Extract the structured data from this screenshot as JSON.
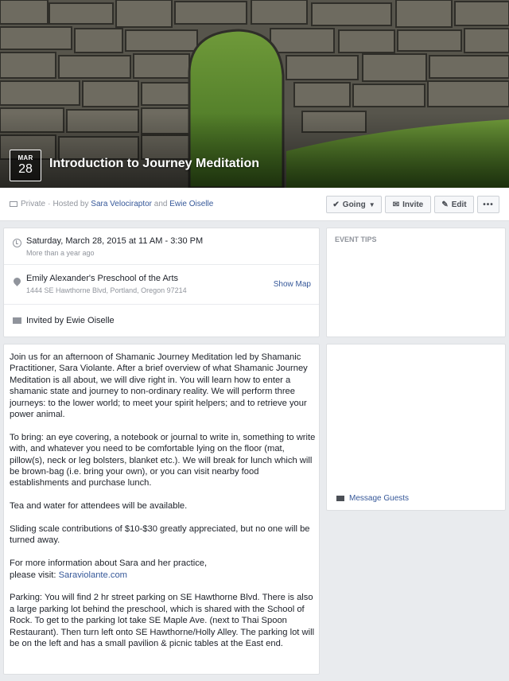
{
  "event": {
    "month": "MAR",
    "day": "28",
    "title": "Introduction to Journey Meditation"
  },
  "header": {
    "privacy": "Private",
    "hosted_by_prefix": "Hosted by",
    "host1": "Sara Velociraptor",
    "and": "and",
    "host2": "Ewie Oiselle",
    "buttons": {
      "going": "Going",
      "invite": "Invite",
      "edit": "Edit",
      "more": "•••"
    }
  },
  "details": {
    "datetime": "Saturday, March 28, 2015 at 11 AM - 3:30 PM",
    "relative": "More than a year ago",
    "venue": "Emily Alexander's Preschool of the Arts",
    "address": "1444 SE Hawthorne Blvd, Portland, Oregon 97214",
    "show_map": "Show Map",
    "invited_by": "Invited by Ewie Oiselle"
  },
  "tips": {
    "header": "EVENT TIPS"
  },
  "sidebar": {
    "message_guests": "Message Guests"
  },
  "description": {
    "p1": "Join us for an afternoon of Shamanic Journey Meditation led by Shamanic Practitioner, Sara Violante. After a brief overview of what Shamanic Journey Meditation is all about, we will dive right in. You will learn how to enter a shamanic state and journey to non-ordinary reality. We will perform three journeys: to the lower world; to meet your spirit helpers; and to retrieve your power animal.",
    "p2": "To bring: an eye covering, a notebook or journal to write in, something to write with, and whatever you need to be comfortable lying on the floor (mat, pillow(s), neck or leg bolsters, blanket etc.). We will break for lunch which will be brown-bag (i.e. bring your own), or you can visit nearby food establishments and purchase lunch.",
    "p3": "Tea and water for attendees will be available.",
    "p4": "Sliding scale contributions of $10-$30 greatly appreciated, but no one will be turned away.",
    "p5a": "For more information about Sara and her practice,",
    "p5b": "please visit:",
    "link": "Saraviolante.com",
    "p6": "Parking: You will find 2 hr street parking on SE Hawthorne Blvd. There is also a large parking lot behind the preschool, which is shared with the School of Rock. To get to the parking lot take SE Maple Ave. (next to Thai Spoon Restaurant). Then turn left onto SE Hawthorne/Holly Alley. The parking lot will be on the left and has a small pavilion & picnic tables at the East end."
  },
  "colors": {
    "link": "#365899",
    "muted": "#90949c",
    "background": "#e9ebee"
  }
}
